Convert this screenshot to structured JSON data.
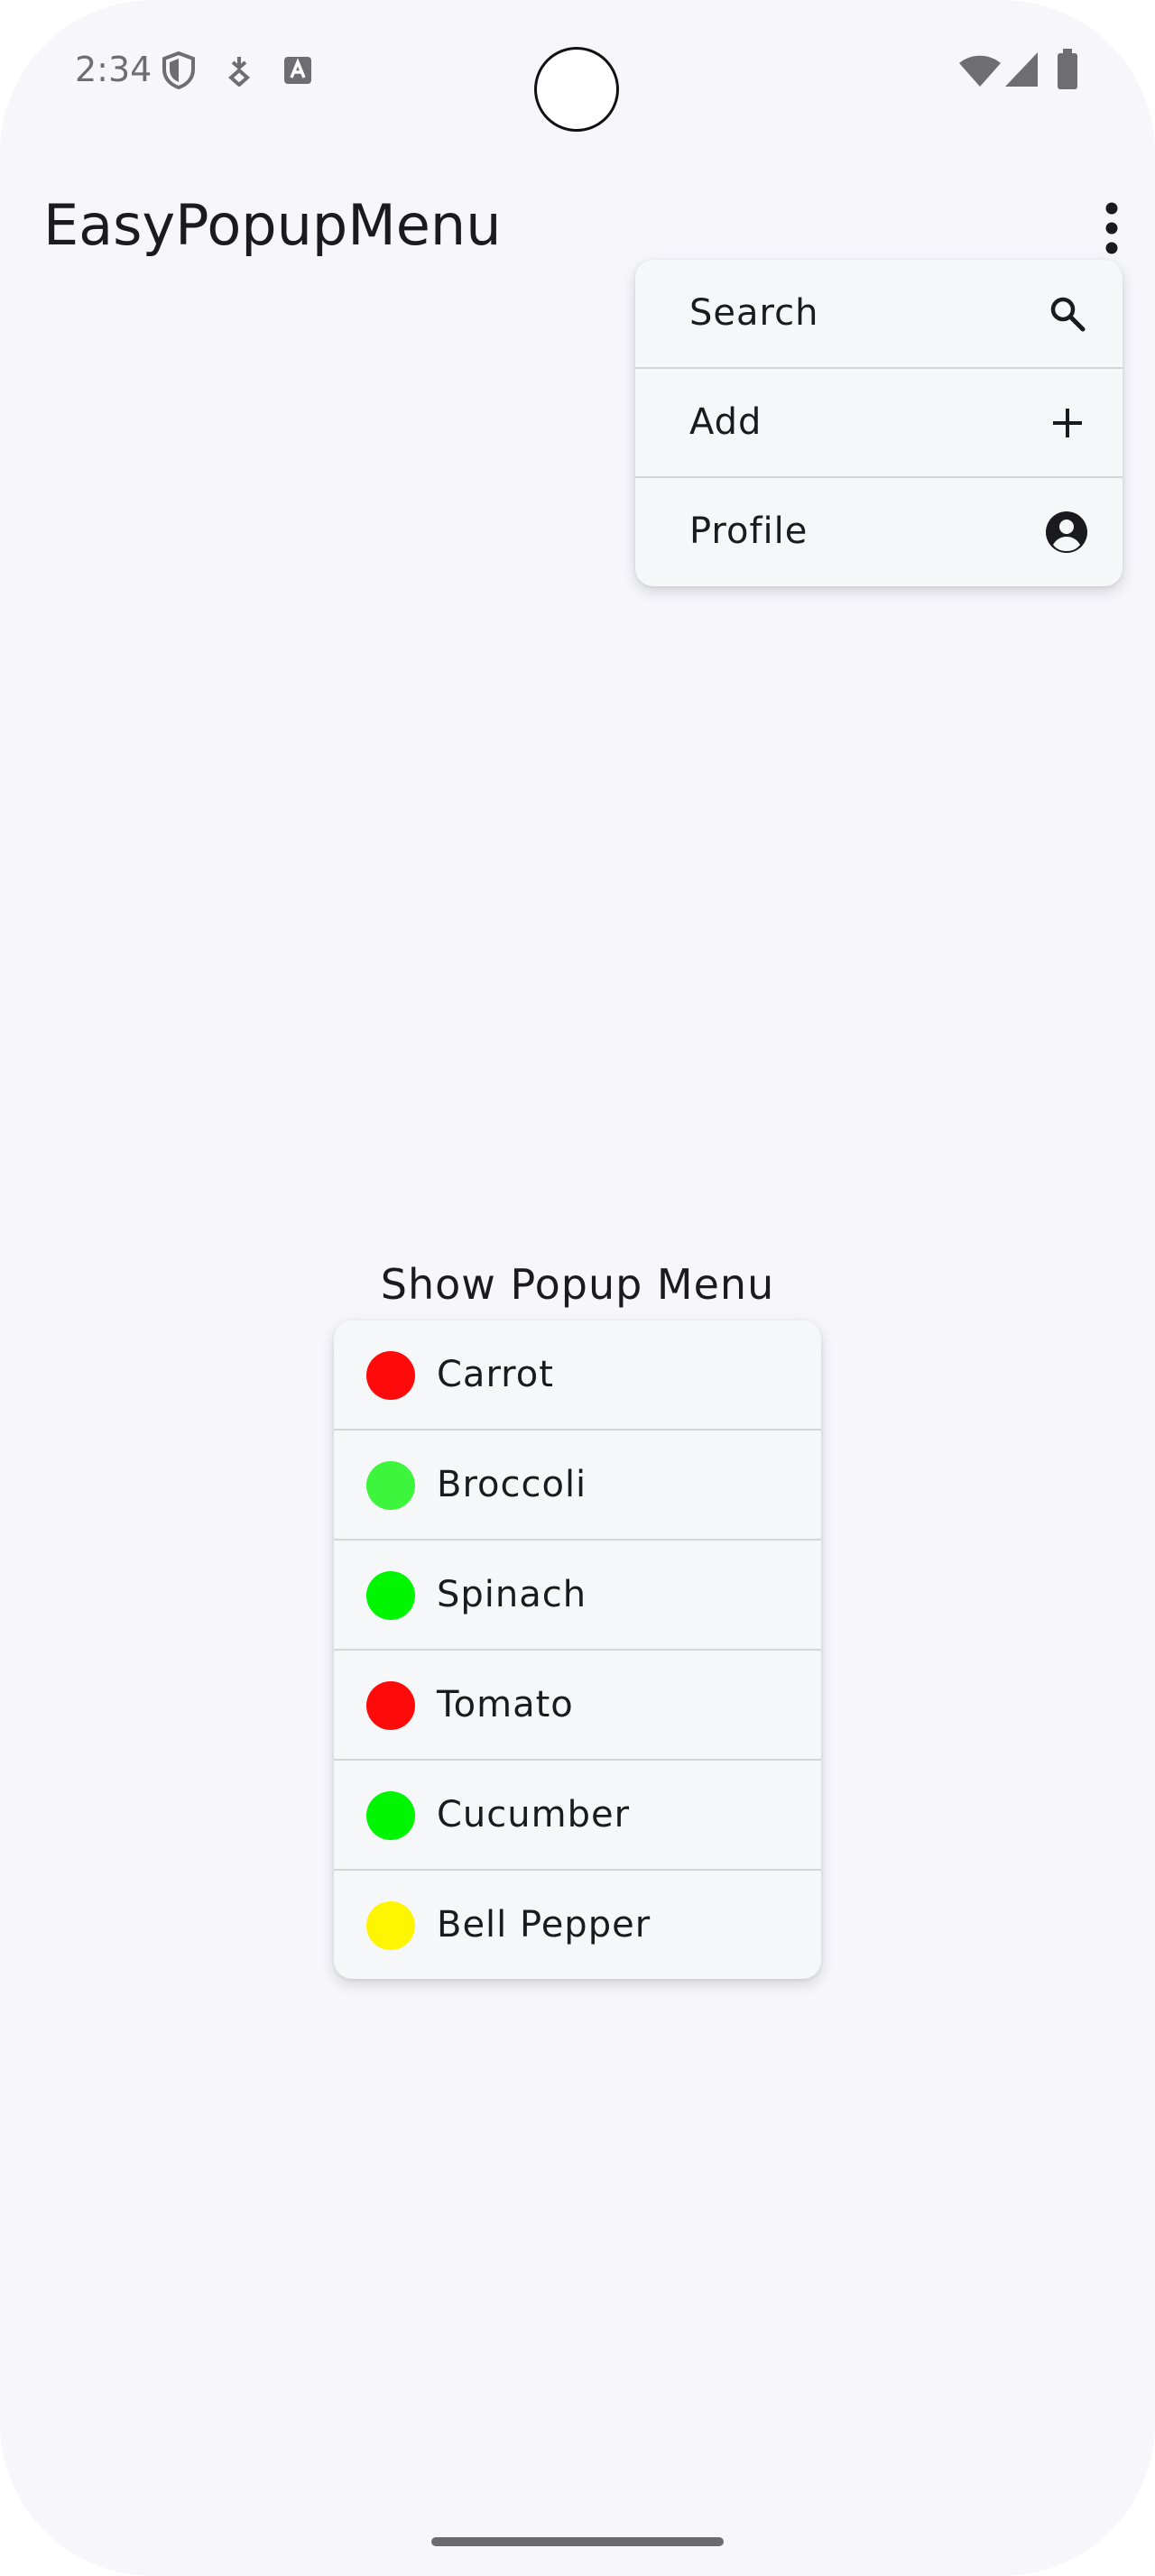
{
  "status_bar": {
    "time": "2:34",
    "icons_left": [
      "shield-icon",
      "download-status-icon",
      "text-a-icon"
    ],
    "icons_right": [
      "wifi-icon",
      "cellular-signal-icon",
      "battery-icon"
    ]
  },
  "app_bar": {
    "title": "EasyPopupMenu",
    "overflow_icon": "more-vert-icon"
  },
  "top_menu": {
    "items": [
      {
        "label": "Search",
        "icon": "search-icon"
      },
      {
        "label": "Add",
        "icon": "add-icon"
      },
      {
        "label": "Profile",
        "icon": "account-circle-icon"
      }
    ]
  },
  "center": {
    "show_popup_label": "Show Popup Menu"
  },
  "vegetable_menu": {
    "items": [
      {
        "label": "Carrot",
        "color": "#ff0a0a"
      },
      {
        "label": "Broccoli",
        "color": "#3cf53c"
      },
      {
        "label": "Spinach",
        "color": "#00f500"
      },
      {
        "label": "Tomato",
        "color": "#ff0a0a"
      },
      {
        "label": "Cucumber",
        "color": "#00f500"
      },
      {
        "label": "Bell Pepper",
        "color": "#fff500"
      }
    ]
  }
}
